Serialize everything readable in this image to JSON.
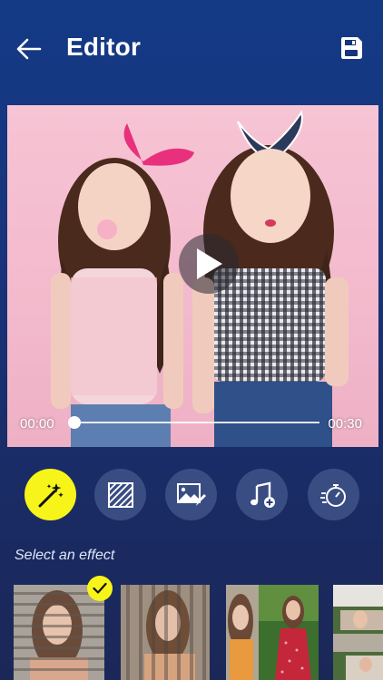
{
  "header": {
    "title": "Editor",
    "back_icon": "arrow-left-icon",
    "save_icon": "floppy-disk-icon"
  },
  "player": {
    "current_time": "00:00",
    "total_time": "00:30",
    "progress": 0.0,
    "play_icon": "play-icon"
  },
  "tools": [
    {
      "name": "effect",
      "icon": "magic-wand-icon",
      "active": true
    },
    {
      "name": "frame",
      "icon": "diagonal-lines-icon",
      "active": false
    },
    {
      "name": "edit-image",
      "icon": "image-edit-icon",
      "active": false
    },
    {
      "name": "add-music",
      "icon": "music-add-icon",
      "active": false
    },
    {
      "name": "duration",
      "icon": "stopwatch-icon",
      "active": false
    }
  ],
  "effects": {
    "label": "Select an effect",
    "selected_index": 0
  },
  "colors": {
    "accent": "#f7f41a",
    "background_top": "#143a86",
    "background_bottom": "#1b2757"
  }
}
